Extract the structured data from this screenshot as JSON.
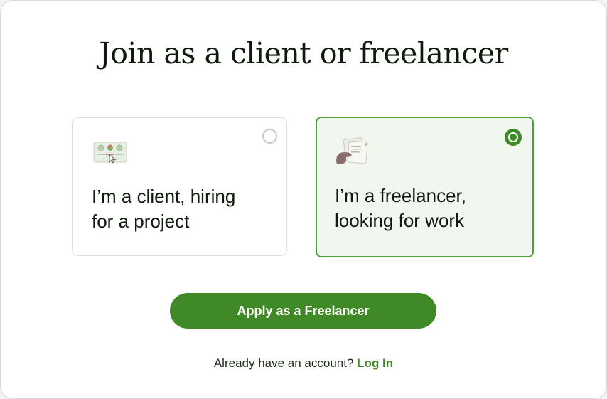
{
  "page": {
    "title": "Join as a client or freelancer"
  },
  "options": [
    {
      "id": "client",
      "label": "I’m a client, hiring\nfor a project",
      "selected": false,
      "icon": "client-dashboard-icon"
    },
    {
      "id": "freelancer",
      "label": "I’m a freelancer,\nlooking for work",
      "selected": true,
      "icon": "freelancer-documents-icon"
    }
  ],
  "actions": {
    "apply_label": "Apply as a Freelancer"
  },
  "login": {
    "prompt": "Already have an account?",
    "link_label": "Log In"
  },
  "colors": {
    "accent": "#3f8a26",
    "selected_border": "#4da339",
    "selected_bg": "#f1f7ef",
    "text": "#0e1a0c"
  }
}
